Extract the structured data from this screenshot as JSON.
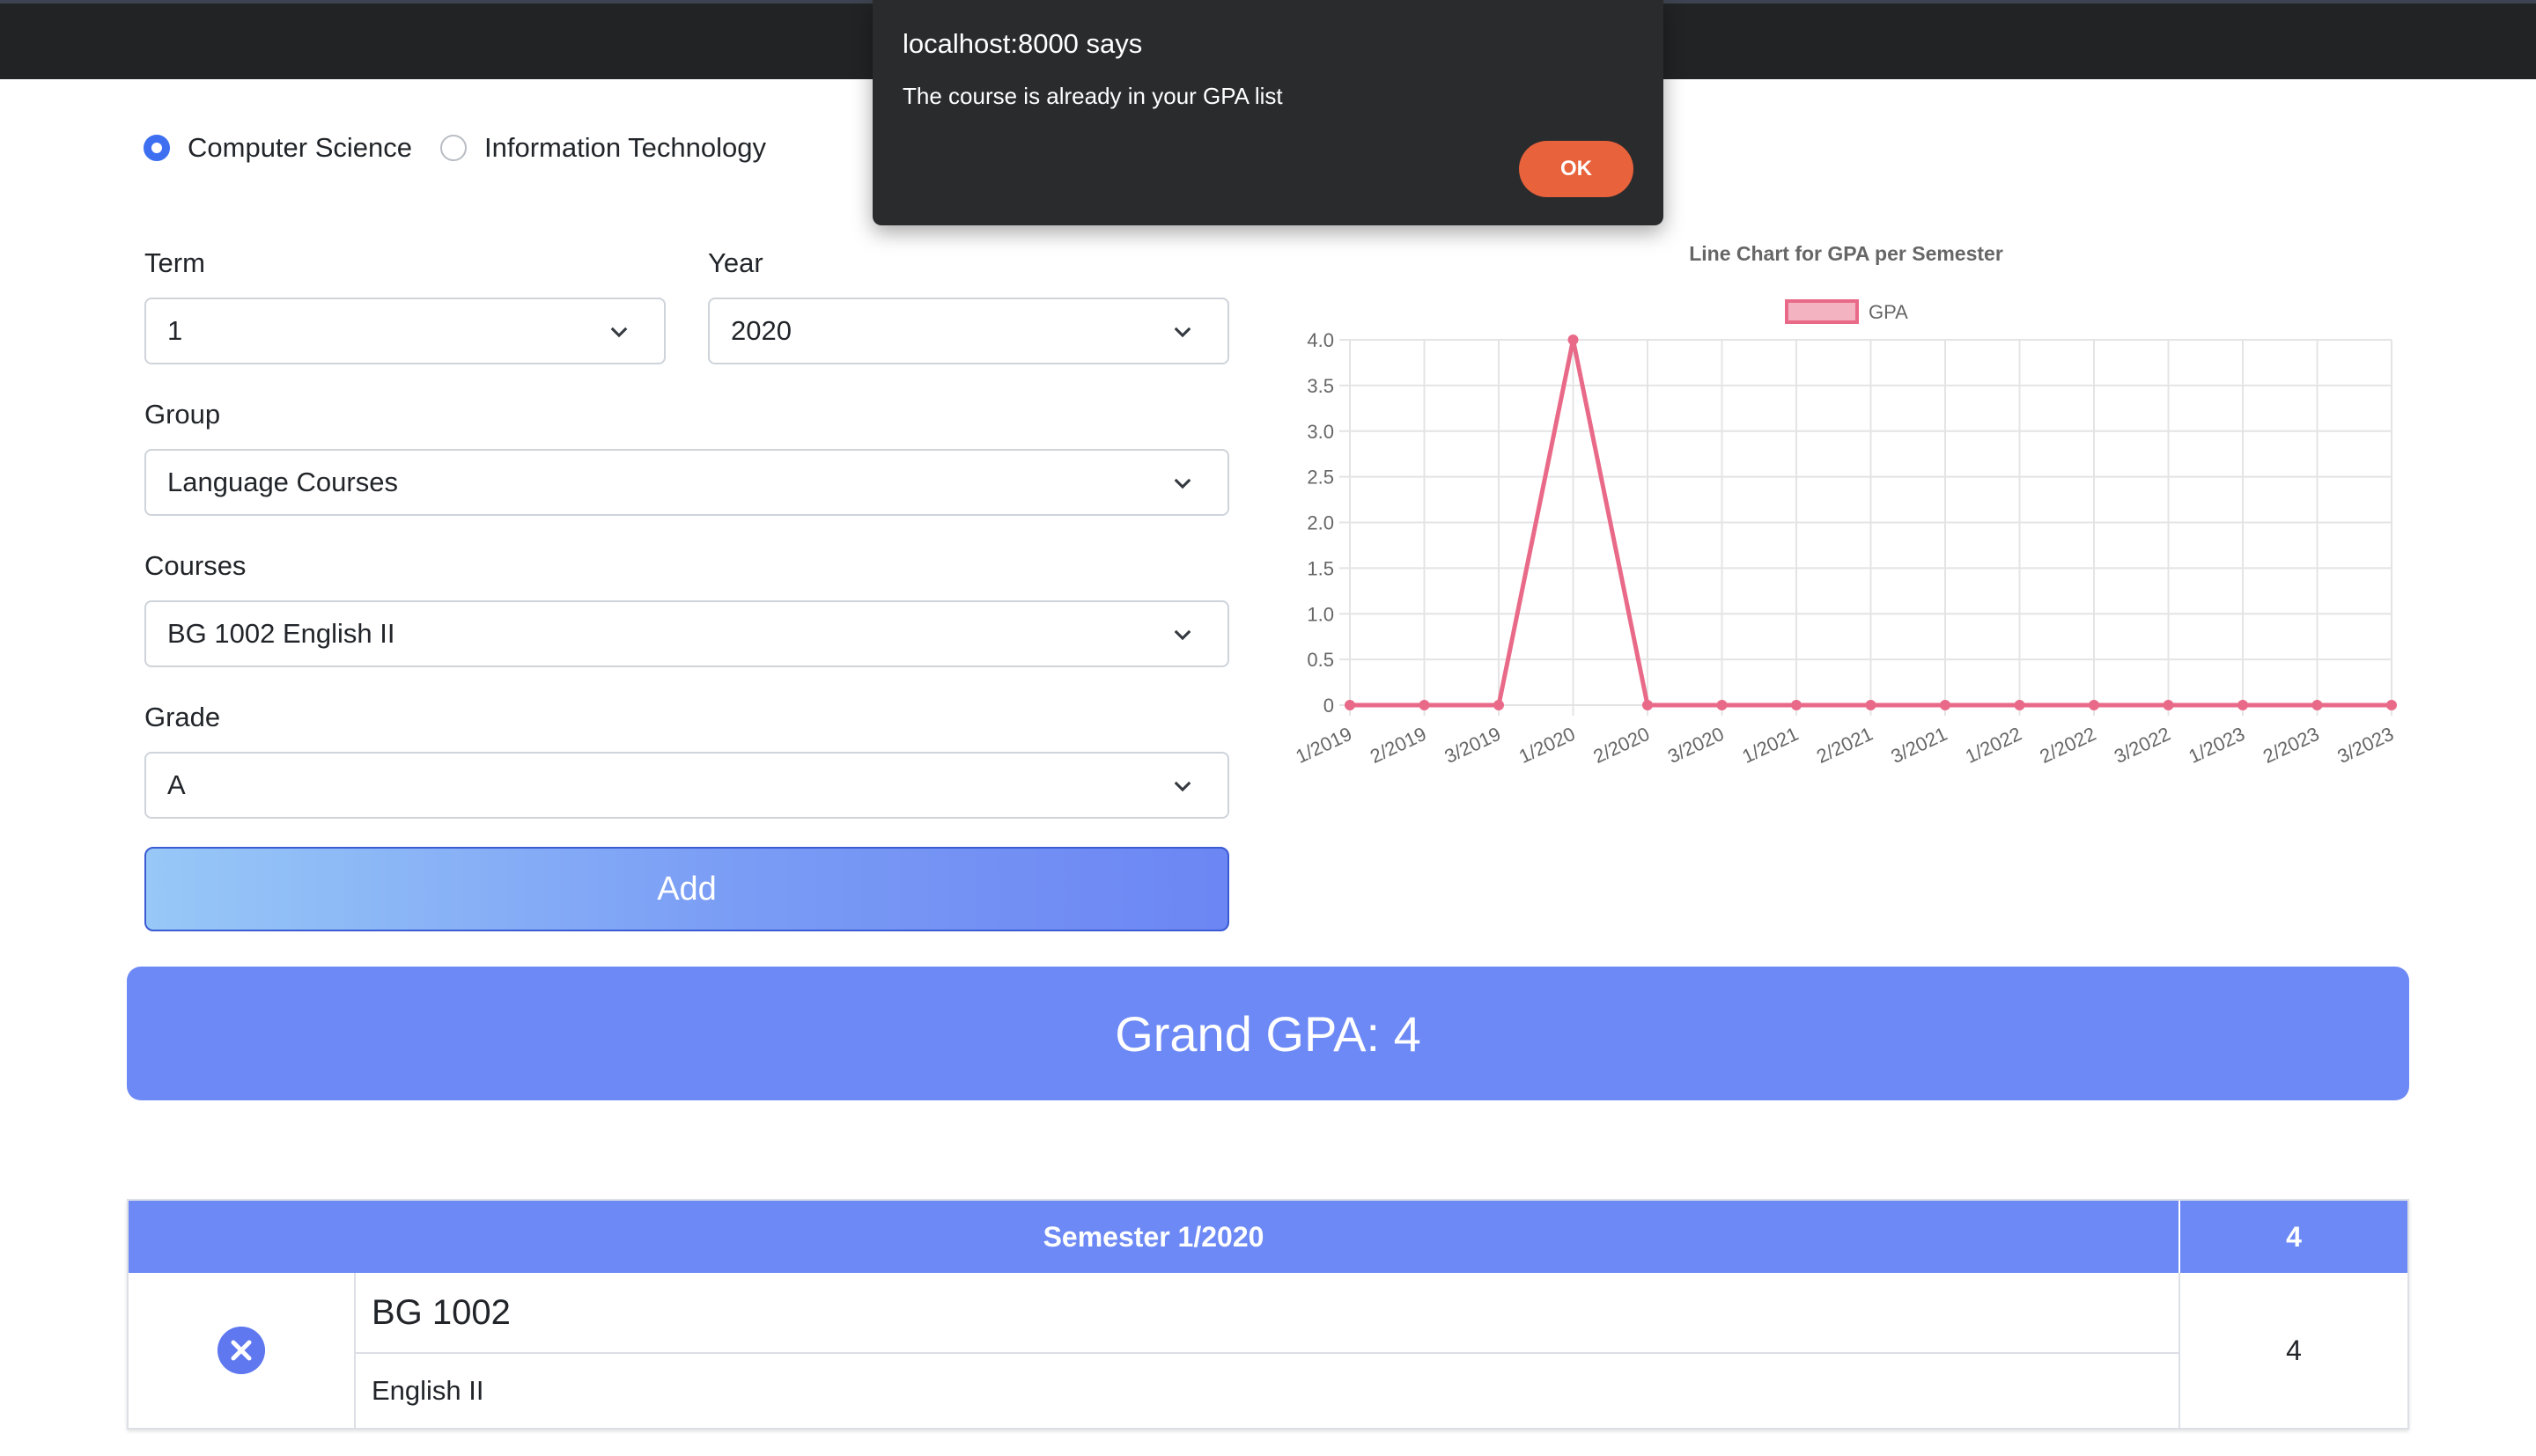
{
  "dialog": {
    "title": "localhost:8000 says",
    "message": "The course is already in your GPA list",
    "ok_label": "OK"
  },
  "program": {
    "options": [
      "Computer Science",
      "Information Technology"
    ],
    "selected": "Computer Science"
  },
  "form": {
    "term_label": "Term",
    "term_value": "1",
    "year_label": "Year",
    "year_value": "2020",
    "group_label": "Group",
    "group_value": "Language Courses",
    "courses_label": "Courses",
    "courses_value": "BG 1002 English II",
    "grade_label": "Grade",
    "grade_value": "A",
    "add_label": "Add"
  },
  "grand_gpa": "Grand GPA: 4",
  "table": {
    "semester_header": "Semester 1/2020",
    "semester_gpa": "4",
    "rows": [
      {
        "code": "BG 1002",
        "name": "English II",
        "grade": "4"
      }
    ]
  },
  "chart_data": {
    "type": "line",
    "title": "Line Chart for GPA per Semester",
    "categories": [
      "1/2019",
      "2/2019",
      "3/2019",
      "1/2020",
      "2/2020",
      "3/2020",
      "1/2021",
      "2/2021",
      "3/2021",
      "1/2022",
      "2/2022",
      "3/2022",
      "1/2023",
      "2/2023",
      "3/2023"
    ],
    "series": [
      {
        "name": "GPA",
        "values": [
          0,
          0,
          0,
          4,
          0,
          0,
          0,
          0,
          0,
          0,
          0,
          0,
          0,
          0,
          0
        ],
        "color": "#e96a88"
      }
    ],
    "yticks": [
      "0",
      "0.5",
      "1.0",
      "1.5",
      "2.0",
      "2.5",
      "3.0",
      "3.5",
      "4.0"
    ],
    "ylim": [
      0,
      4
    ],
    "legend": "top",
    "grid": true
  }
}
